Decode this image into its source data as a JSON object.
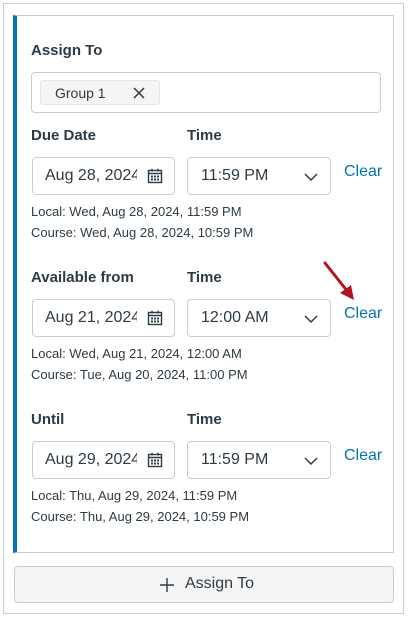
{
  "assign": {
    "label": "Assign To",
    "chips": [
      {
        "label": "Group 1"
      }
    ]
  },
  "sections": [
    {
      "date_label": "Due Date",
      "time_label": "Time",
      "date_value": "Aug 28, 2024",
      "time_value": "11:59 PM",
      "clear_label": "Clear",
      "local": "Local: Wed, Aug 28, 2024, 11:59 PM",
      "course": "Course: Wed, Aug 28, 2024, 10:59 PM"
    },
    {
      "date_label": "Available from",
      "time_label": "Time",
      "date_value": "Aug 21, 2024",
      "time_value": "12:00 AM",
      "clear_label": "Clear",
      "local": "Local: Wed, Aug 21, 2024, 12:00 AM",
      "course": "Course: Tue, Aug 20, 2024, 11:00 PM"
    },
    {
      "date_label": "Until",
      "time_label": "Time",
      "date_value": "Aug 29, 2024",
      "time_value": "11:59 PM",
      "clear_label": "Clear",
      "local": "Local: Thu, Aug 29, 2024, 11:59 PM",
      "course": "Course: Thu, Aug 29, 2024, 10:59 PM"
    }
  ],
  "add_button": {
    "label": "Assign To",
    "icon": "plus-icon"
  },
  "icons": {
    "calendar": "calendar-icon",
    "chevron": "chevron-down-icon",
    "remove": "close-icon"
  },
  "colors": {
    "accent": "#0374b5",
    "arrow": "#b0151e",
    "border": "#c7cdd1"
  }
}
